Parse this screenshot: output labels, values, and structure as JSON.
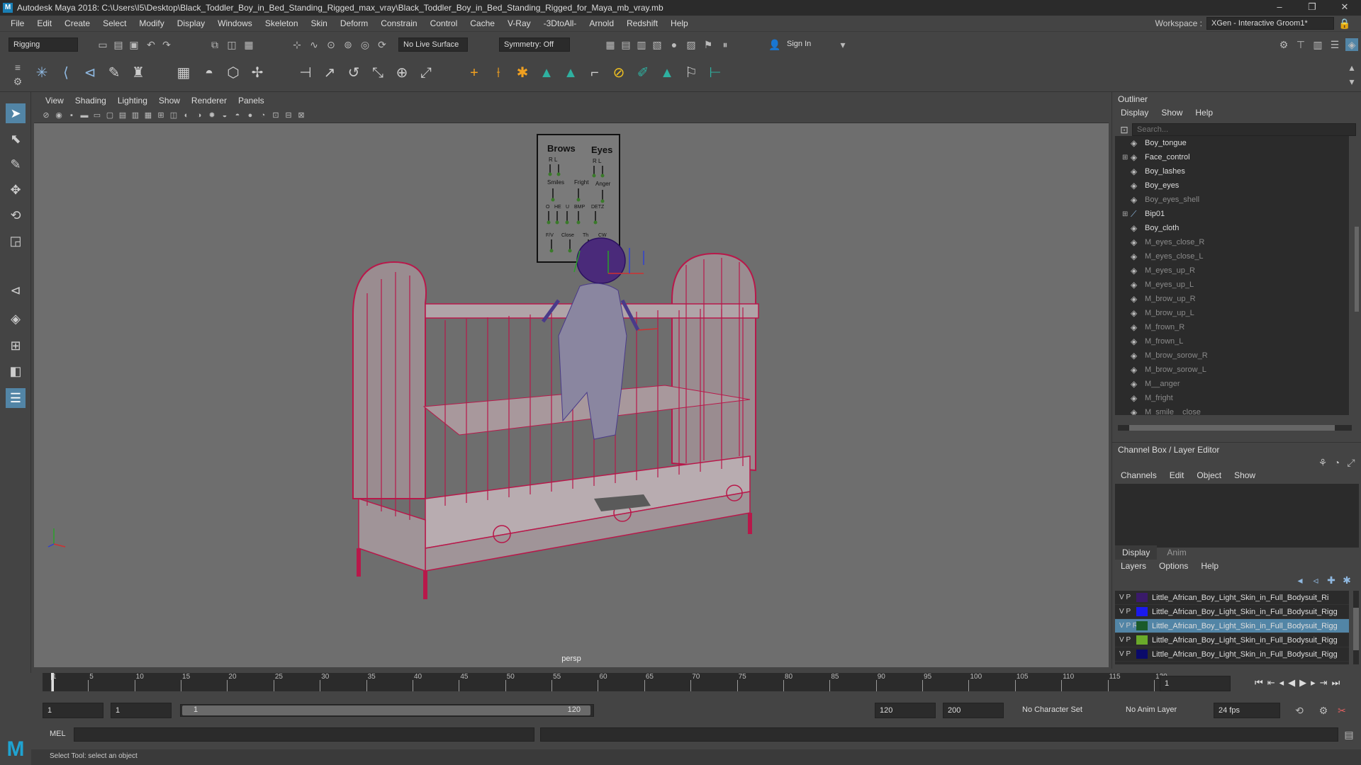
{
  "window": {
    "title": "Autodesk Maya 2018: C:\\Users\\I5\\Desktop\\Black_Toddler_Boy_in_Bed_Standing_Rigged_max_vray\\Black_Toddler_Boy_in_Bed_Standing_Rigged_for_Maya_mb_vray.mb",
    "controls": [
      "–",
      "❐",
      "✕"
    ]
  },
  "menu": [
    "File",
    "Edit",
    "Create",
    "Select",
    "Modify",
    "Display",
    "Windows",
    "Skeleton",
    "Skin",
    "Deform",
    "Constrain",
    "Control",
    "Cache",
    "V-Ray",
    "-3DtoAll-",
    "Arnold",
    "Redshift",
    "Help"
  ],
  "workspace": {
    "label": "Workspace :",
    "value": "XGen - Interactive Groom1*"
  },
  "toolbar": {
    "mode": "Rigging",
    "live_surface": "No Live Surface",
    "symmetry": "Symmetry: Off",
    "sign_in": "Sign In"
  },
  "viewport": {
    "menu": [
      "View",
      "Shading",
      "Lighting",
      "Show",
      "Renderer",
      "Panels"
    ],
    "camera_label": "persp",
    "face_panel": {
      "headings": [
        "Brows",
        "Eyes"
      ],
      "sub_rl": "R   L",
      "labels_row1": [
        "Smiles",
        "Fright",
        "Anger"
      ],
      "labels_row2": [
        "O",
        "HE",
        "U",
        "BMP",
        "DETZ"
      ],
      "labels_row3": [
        "F/V",
        "Close",
        "Th",
        "CW"
      ]
    }
  },
  "outliner": {
    "title": "Outliner",
    "menu": [
      "Display",
      "Show",
      "Help"
    ],
    "search_placeholder": "Search...",
    "items": [
      {
        "name": "Boy_tongue",
        "dim": false,
        "expand": false
      },
      {
        "name": "Face_control",
        "dim": false,
        "expand": true
      },
      {
        "name": "Boy_lashes",
        "dim": false,
        "expand": false
      },
      {
        "name": "Boy_eyes",
        "dim": false,
        "expand": false
      },
      {
        "name": "Boy_eyes_shell",
        "dim": true,
        "expand": false
      },
      {
        "name": "Bip01",
        "dim": false,
        "expand": true
      },
      {
        "name": "Boy_cloth",
        "dim": false,
        "expand": false
      },
      {
        "name": "M_eyes_close_R",
        "dim": true,
        "expand": false
      },
      {
        "name": "M_eyes_close_L",
        "dim": true,
        "expand": false
      },
      {
        "name": "M_eyes_up_R",
        "dim": true,
        "expand": false
      },
      {
        "name": "M_eyes_up_L",
        "dim": true,
        "expand": false
      },
      {
        "name": "M_brow_up_R",
        "dim": true,
        "expand": false
      },
      {
        "name": "M_brow_up_L",
        "dim": true,
        "expand": false
      },
      {
        "name": "M_frown_R",
        "dim": true,
        "expand": false
      },
      {
        "name": "M_frown_L",
        "dim": true,
        "expand": false
      },
      {
        "name": "M_brow_sorow_R",
        "dim": true,
        "expand": false
      },
      {
        "name": "M_brow_sorow_L",
        "dim": true,
        "expand": false
      },
      {
        "name": "M__anger",
        "dim": true,
        "expand": false
      },
      {
        "name": "M_fright",
        "dim": true,
        "expand": false
      },
      {
        "name": "M_smile__close",
        "dim": true,
        "expand": false
      }
    ]
  },
  "channel_box": {
    "title": "Channel Box / Layer Editor",
    "menu": [
      "Channels",
      "Edit",
      "Object",
      "Show"
    ]
  },
  "layer_editor": {
    "tabs": [
      "Display",
      "Anim"
    ],
    "menu": [
      "Layers",
      "Options",
      "Help"
    ],
    "layers": [
      {
        "vp": "V P",
        "name": "Little_African_Boy_Light_Skin_in_Full_Bodysuit_Ri",
        "color": "#3a1a6a",
        "selected": false
      },
      {
        "vp": "V P",
        "name": "Little_African_Boy_Light_Skin_in_Full_Bodysuit_Rigg",
        "color": "#1a1aee",
        "selected": false
      },
      {
        "vp": "V P R",
        "name": "Little_African_Boy_Light_Skin_in_Full_Bodysuit_Rigg",
        "color": "#1a5a2a",
        "selected": true
      },
      {
        "vp": "V P",
        "name": "Little_African_Boy_Light_Skin_in_Full_Bodysuit_Rigg",
        "color": "#6aaa2a",
        "selected": false
      },
      {
        "vp": "V P",
        "name": "Little_African_Boy_Light_Skin_in_Full_Bodysuit_Rigg",
        "color": "#0a0a6a",
        "selected": false
      }
    ]
  },
  "timeline": {
    "ticks": [
      "1",
      "5",
      "10",
      "15",
      "20",
      "25",
      "30",
      "35",
      "40",
      "45",
      "50",
      "55",
      "60",
      "65",
      "70",
      "75",
      "80",
      "85",
      "90",
      "95",
      "100",
      "105",
      "110",
      "115",
      "120"
    ],
    "current_frame": "1"
  },
  "range": {
    "start": "1",
    "playback_start": "1",
    "slider_start": "1",
    "slider_end": "120",
    "playback_end": "120",
    "end": "200",
    "character_set": "No Character Set",
    "anim_layer": "No Anim Layer",
    "fps": "24 fps"
  },
  "command_line": {
    "label": "MEL"
  },
  "status_line": "Select Tool: select an object"
}
